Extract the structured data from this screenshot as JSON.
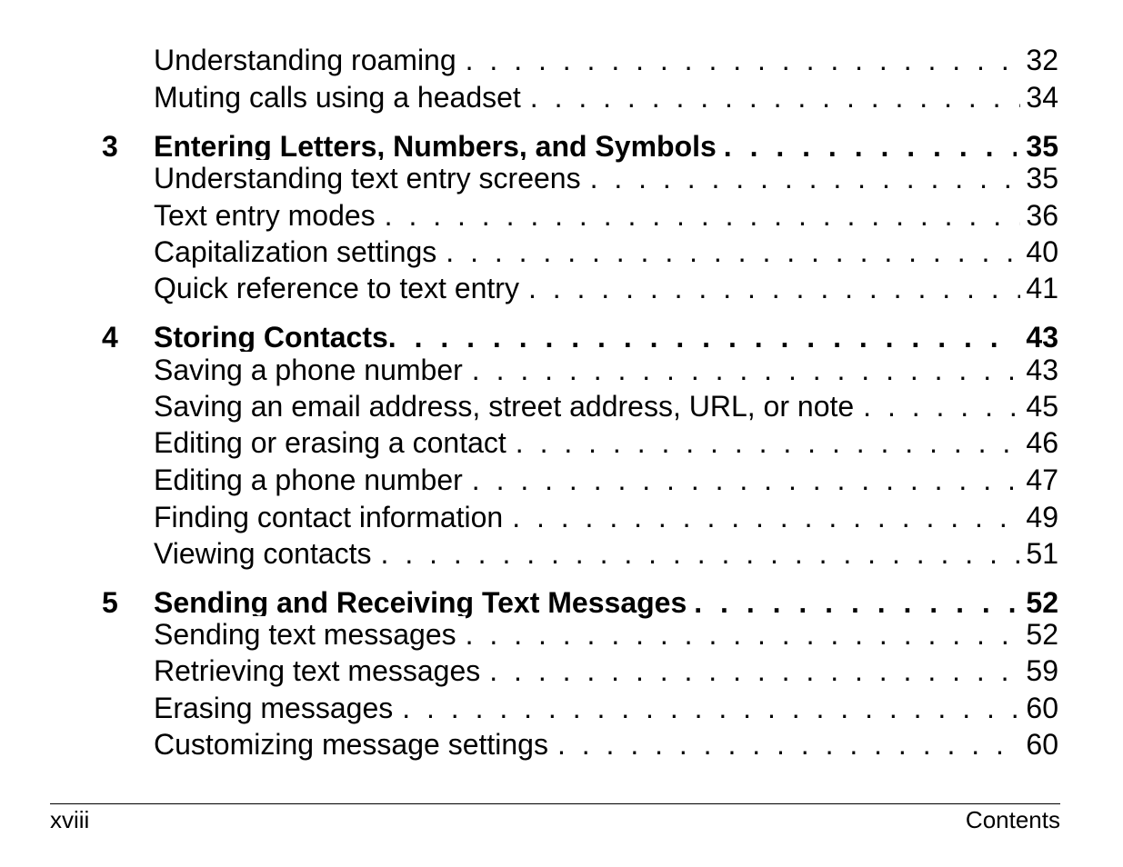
{
  "toc": {
    "entries_top": [
      {
        "title": "Understanding roaming",
        "page": "32"
      },
      {
        "title": "Muting calls using a headset",
        "page": "34"
      }
    ],
    "chapters": [
      {
        "number": "3",
        "title": "Entering Letters, Numbers, and Symbols",
        "page": "35",
        "sections": [
          {
            "title": "Understanding text entry screens",
            "page": "35"
          },
          {
            "title": "Text entry modes",
            "page": "36"
          },
          {
            "title": "Capitalization settings",
            "page": "40"
          },
          {
            "title": "Quick reference to text entry",
            "page": "41"
          }
        ]
      },
      {
        "number": "4",
        "title": "Storing Contacts",
        "page": "43",
        "sections": [
          {
            "title": "Saving a phone number",
            "page": "43"
          },
          {
            "title": "Saving an email address, street address, URL, or note",
            "page": "45"
          },
          {
            "title": "Editing or erasing a contact",
            "page": "46"
          },
          {
            "title": "Editing a phone number",
            "page": "47"
          },
          {
            "title": "Finding contact information",
            "page": "49"
          },
          {
            "title": "Viewing contacts",
            "page": "51"
          }
        ]
      },
      {
        "number": "5",
        "title": "Sending and Receiving Text Messages",
        "page": "52",
        "sections": [
          {
            "title": "Sending text messages",
            "page": "52"
          },
          {
            "title": "Retrieving text messages",
            "page": "59"
          },
          {
            "title": "Erasing messages",
            "page": "60"
          },
          {
            "title": "Customizing message settings",
            "page": "60"
          }
        ]
      }
    ]
  },
  "footer": {
    "page_number": "xviii",
    "section": "Contents"
  }
}
